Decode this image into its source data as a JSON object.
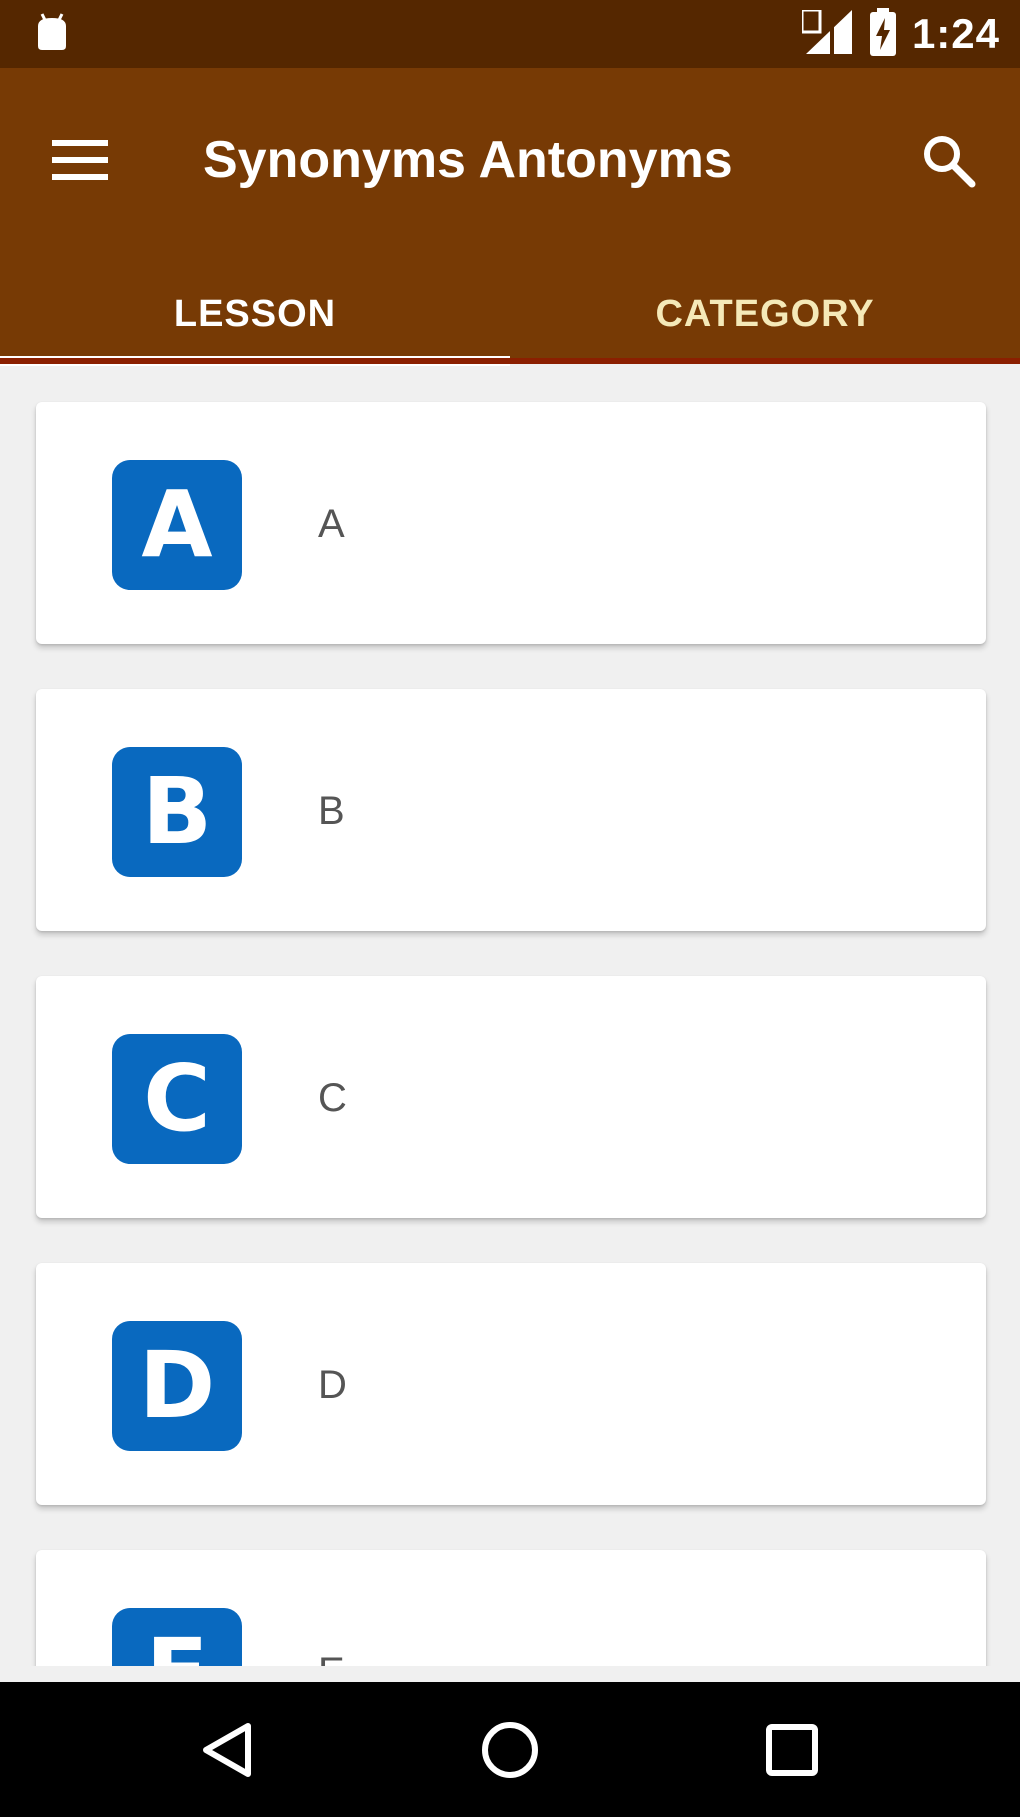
{
  "status_bar": {
    "time": "1:24",
    "icons": [
      "android-notification-icon",
      "signal-icon",
      "battery-charging-icon"
    ]
  },
  "app_bar": {
    "title": "Synonyms Antonyms",
    "menu_icon": "menu-icon",
    "search_icon": "search-icon",
    "background": "#773a05"
  },
  "tabs": [
    {
      "label": "LESSON",
      "active": true
    },
    {
      "label": "CATEGORY",
      "active": false
    }
  ],
  "lessons": [
    {
      "badge": "A",
      "label": "A"
    },
    {
      "badge": "B",
      "label": "B"
    },
    {
      "badge": "C",
      "label": "C"
    },
    {
      "badge": "D",
      "label": "D"
    },
    {
      "badge": "E",
      "label": "E"
    }
  ],
  "colors": {
    "status_bar": "#552700",
    "badge": "#0969bf",
    "list_background": "#f0f0f0"
  },
  "nav_bar": {
    "buttons": [
      "back-icon",
      "home-icon",
      "recents-icon"
    ]
  }
}
